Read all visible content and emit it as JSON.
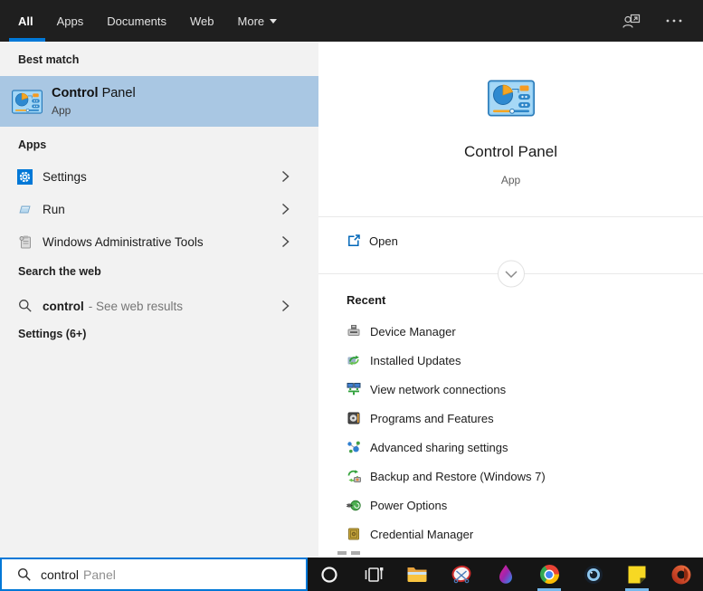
{
  "header": {
    "tabs": [
      {
        "label": "All",
        "active": true
      },
      {
        "label": "Apps",
        "active": false
      },
      {
        "label": "Documents",
        "active": false
      },
      {
        "label": "Web",
        "active": false
      },
      {
        "label": "More",
        "active": false,
        "has_dropdown": true
      }
    ],
    "icons": [
      "sign-in-options-icon",
      "ellipsis-icon"
    ]
  },
  "left_panel": {
    "best_match_header": "Best match",
    "best_match": {
      "icon": "control-panel-icon",
      "title_bold": "Control",
      "title_rest": " Panel",
      "subtitle": "App"
    },
    "apps_header": "Apps",
    "apps": [
      {
        "label": "Settings",
        "icon": "settings-icon"
      },
      {
        "label": "Run",
        "icon": "run-icon"
      },
      {
        "label": "Windows Administrative Tools",
        "icon": "admin-tools-icon"
      }
    ],
    "search_web_header": "Search the web",
    "web_item": {
      "icon": "search-icon",
      "query": "control",
      "suffix": "- See web results"
    },
    "settings_header": "Settings (6+)"
  },
  "preview": {
    "icon": "control-panel-icon",
    "title": "Control Panel",
    "subtitle": "App",
    "open_label": "Open",
    "open_icon": "open-external-icon",
    "expand_icon": "chevron-down-icon",
    "recent_header": "Recent",
    "recent": [
      {
        "label": "Device Manager",
        "icon": "device-manager-icon"
      },
      {
        "label": "Installed Updates",
        "icon": "installed-updates-icon"
      },
      {
        "label": "View network connections",
        "icon": "network-connections-icon"
      },
      {
        "label": "Programs and Features",
        "icon": "programs-features-icon"
      },
      {
        "label": "Advanced sharing settings",
        "icon": "sharing-settings-icon"
      },
      {
        "label": "Backup and Restore (Windows 7)",
        "icon": "backup-restore-icon"
      },
      {
        "label": "Power Options",
        "icon": "power-options-icon"
      },
      {
        "label": "Credential Manager",
        "icon": "credential-manager-icon"
      }
    ]
  },
  "search_bar": {
    "icon": "search-icon",
    "value": "control",
    "suggestion": "Panel"
  },
  "taskbar": {
    "icons": [
      "cortana-icon",
      "task-view-icon",
      "file-explorer-icon",
      "snipping-tool-icon",
      "paint-3d-icon",
      "chrome-icon",
      "lens-app-icon",
      "sticky-notes-icon",
      "office-icon"
    ],
    "running_indicator_on": [
      "chrome-icon",
      "sticky-notes-icon"
    ]
  },
  "colors": {
    "header_bg": "#1f1f1f",
    "accent_blue": "#0078d7",
    "left_panel_bg": "#f2f2f2",
    "selection_blue": "#a9c7e3",
    "taskbar_bg": "#151515",
    "running_indicator": "#76b9ed"
  }
}
